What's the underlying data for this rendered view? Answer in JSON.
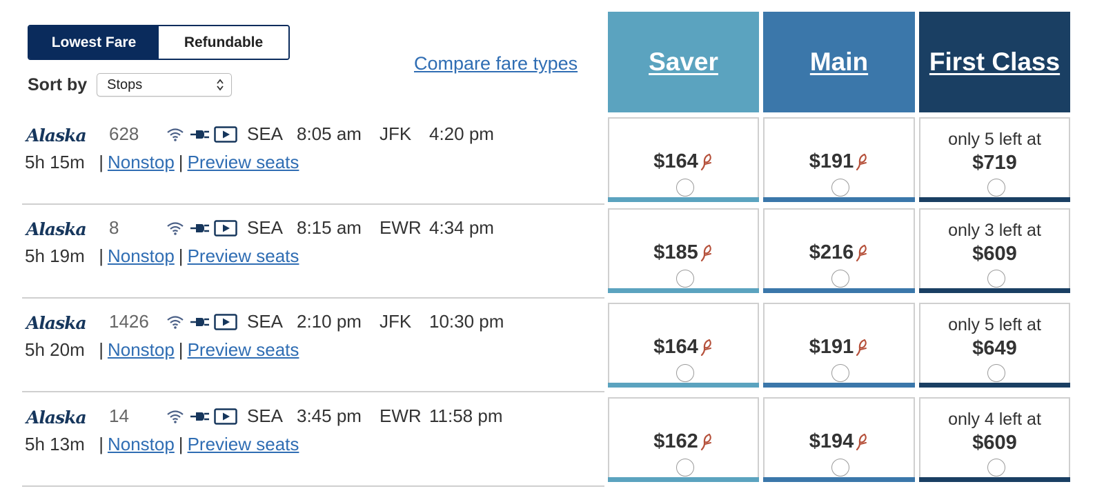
{
  "fare_toggle": {
    "lowest_label": "Lowest Fare",
    "refundable_label": "Refundable"
  },
  "sort": {
    "label": "Sort by",
    "selected": "Stops"
  },
  "compare_link": "Compare fare types",
  "columns": [
    {
      "label": "Saver",
      "color": "#5ba3bf"
    },
    {
      "label": "Main",
      "color": "#3b77aa"
    },
    {
      "label": "First Class",
      "color": "#1a3f63"
    }
  ],
  "colors": {
    "toggle_active": "#0a2b5c",
    "link": "#2f6db3",
    "mile_icon": "#b5503a"
  },
  "flights": [
    {
      "flight_number": "628",
      "depart_airport": "SEA",
      "depart_time": "8:05 am",
      "arrive_airport": "JFK",
      "arrive_time": "4:20 pm",
      "duration": "5h 15m",
      "stops": "Nonstop",
      "preview": "Preview seats",
      "saver": "$164",
      "main": "$191",
      "first_text": "only 5 left at",
      "first_price": "$719"
    },
    {
      "flight_number": "8",
      "depart_airport": "SEA",
      "depart_time": "8:15 am",
      "arrive_airport": "EWR",
      "arrive_time": "4:34 pm",
      "duration": "5h 19m",
      "stops": "Nonstop",
      "preview": "Preview seats",
      "saver": "$185",
      "main": "$216",
      "first_text": "only 3 left at",
      "first_price": "$609"
    },
    {
      "flight_number": "1426",
      "depart_airport": "SEA",
      "depart_time": "2:10 pm",
      "arrive_airport": "JFK",
      "arrive_time": "10:30 pm",
      "duration": "5h 20m",
      "stops": "Nonstop",
      "preview": "Preview seats",
      "saver": "$164",
      "main": "$191",
      "first_text": "only 5 left at",
      "first_price": "$649"
    },
    {
      "flight_number": "14",
      "depart_airport": "SEA",
      "depart_time": "3:45 pm",
      "arrive_airport": "EWR",
      "arrive_time": "11:58 pm",
      "duration": "5h 13m",
      "stops": "Nonstop",
      "preview": "Preview seats",
      "saver": "$162",
      "main": "$194",
      "first_text": "only 4 left at",
      "first_price": "$609"
    }
  ],
  "icons": {
    "airline_logo": "alaska-logo",
    "wifi": "wifi-icon",
    "power": "power-plug-icon",
    "entertainment": "play-screen-icon",
    "miles": "miles-feather-icon"
  }
}
